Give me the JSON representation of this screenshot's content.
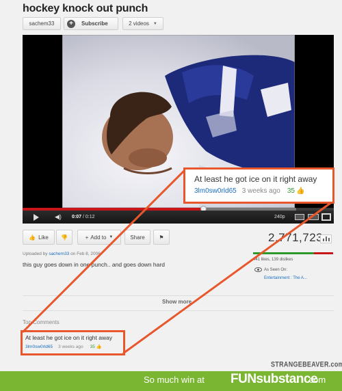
{
  "video": {
    "title": "hockey knock out punch",
    "channel_label": "sachem33",
    "subscribe_label": "Subscribe",
    "videos_label": "2 videos"
  },
  "player": {
    "time_current": "0:07",
    "time_total": "/ 0:12",
    "quality": "240p",
    "progress_played": 0.58,
    "progress_loaded": 0.88
  },
  "highlighted_comment": {
    "text": "At least he got ice on it right away",
    "user": "3lm0sw0rld65",
    "age": "3 weeks ago",
    "likes": "35"
  },
  "actions": {
    "like_label": "Like",
    "add_label": "Add to",
    "share_label": "Share"
  },
  "stats": {
    "views": "2,771,723",
    "likes_dislikes": "441 likes, 139 dislikes",
    "like_ratio": 0.76,
    "seen_on_label": "As Seen On:",
    "seen_on_link": "Entertainment : The A..."
  },
  "uploader": {
    "prefix": "Uploaded by",
    "user": "sachem33",
    "date": "on Feb 8, 2006",
    "description": "this guy goes down in one punch.. and goes down hard"
  },
  "comments": {
    "show_more": "Show more",
    "top_comments": "Top Comments"
  },
  "watermark": "STRANGEBEAVER.com",
  "banner": {
    "text": "So much win at",
    "brand": "FUNsubstance",
    "tld": ".com",
    "color": "#7ab632"
  },
  "colors": {
    "highlight": "#e8562b",
    "link": "#1a6ec1",
    "likes_green": "#2b9a2b",
    "dislikes_red": "#c8151a"
  }
}
